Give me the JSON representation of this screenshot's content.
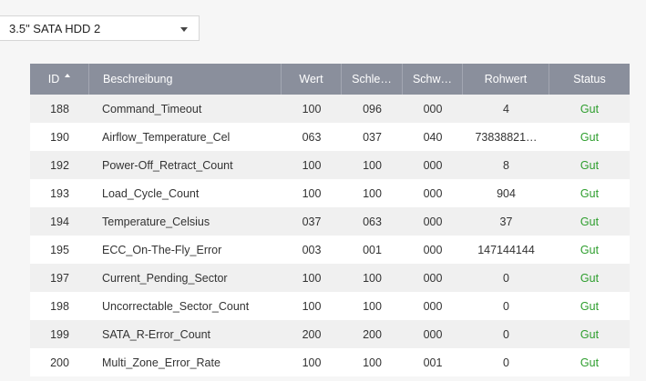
{
  "drive_select": {
    "value": "3.5\" SATA HDD 2"
  },
  "table": {
    "headers": {
      "id": "ID",
      "description": "Beschreibung",
      "value": "Wert",
      "threshold1": "Schle…",
      "threshold2": "Schw…",
      "raw": "Rohwert",
      "status": "Status"
    },
    "rows": [
      {
        "id": "188",
        "description": "Command_Timeout",
        "value": "100",
        "threshold1": "096",
        "threshold2": "000",
        "raw": "4",
        "status": "Gut"
      },
      {
        "id": "190",
        "description": "Airflow_Temperature_Cel",
        "value": "063",
        "threshold1": "037",
        "threshold2": "040",
        "raw": "73838821…",
        "status": "Gut"
      },
      {
        "id": "192",
        "description": "Power-Off_Retract_Count",
        "value": "100",
        "threshold1": "100",
        "threshold2": "000",
        "raw": "8",
        "status": "Gut"
      },
      {
        "id": "193",
        "description": "Load_Cycle_Count",
        "value": "100",
        "threshold1": "100",
        "threshold2": "000",
        "raw": "904",
        "status": "Gut"
      },
      {
        "id": "194",
        "description": "Temperature_Celsius",
        "value": "037",
        "threshold1": "063",
        "threshold2": "000",
        "raw": "37",
        "status": "Gut"
      },
      {
        "id": "195",
        "description": "ECC_On-The-Fly_Error",
        "value": "003",
        "threshold1": "001",
        "threshold2": "000",
        "raw": "147144144",
        "status": "Gut"
      },
      {
        "id": "197",
        "description": "Current_Pending_Sector",
        "value": "100",
        "threshold1": "100",
        "threshold2": "000",
        "raw": "0",
        "status": "Gut"
      },
      {
        "id": "198",
        "description": "Uncorrectable_Sector_Count",
        "value": "100",
        "threshold1": "100",
        "threshold2": "000",
        "raw": "0",
        "status": "Gut"
      },
      {
        "id": "199",
        "description": "SATA_R-Error_Count",
        "value": "200",
        "threshold1": "200",
        "threshold2": "000",
        "raw": "0",
        "status": "Gut"
      },
      {
        "id": "200",
        "description": "Multi_Zone_Error_Rate",
        "value": "100",
        "threshold1": "100",
        "threshold2": "001",
        "raw": "0",
        "status": "Gut"
      }
    ]
  },
  "colors": {
    "header_bg": "#8a8f9c",
    "status_good": "#2e9e2e",
    "page_bg": "#f6f6f6"
  }
}
